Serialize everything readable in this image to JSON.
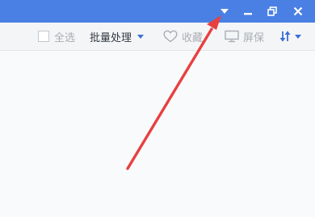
{
  "toolbar": {
    "select_all_label": "全选",
    "batch_label": "批量处理",
    "favorite_label": "收藏",
    "screensaver_label": "屏保"
  },
  "colors": {
    "titlebar": "#4a7fe4",
    "toolbar_bg": "#f4f5f7",
    "content_bg": "#f9fafc",
    "arrow": "#e8403f",
    "accent_icon": "#3a6fd8"
  },
  "icons": {
    "titlebar": [
      "menu-dropdown-icon",
      "minimize-icon",
      "restore-icon",
      "close-icon"
    ],
    "toolbar": [
      "checkbox",
      "caret-down-icon",
      "heart-icon",
      "monitor-icon",
      "sort-icon"
    ]
  }
}
